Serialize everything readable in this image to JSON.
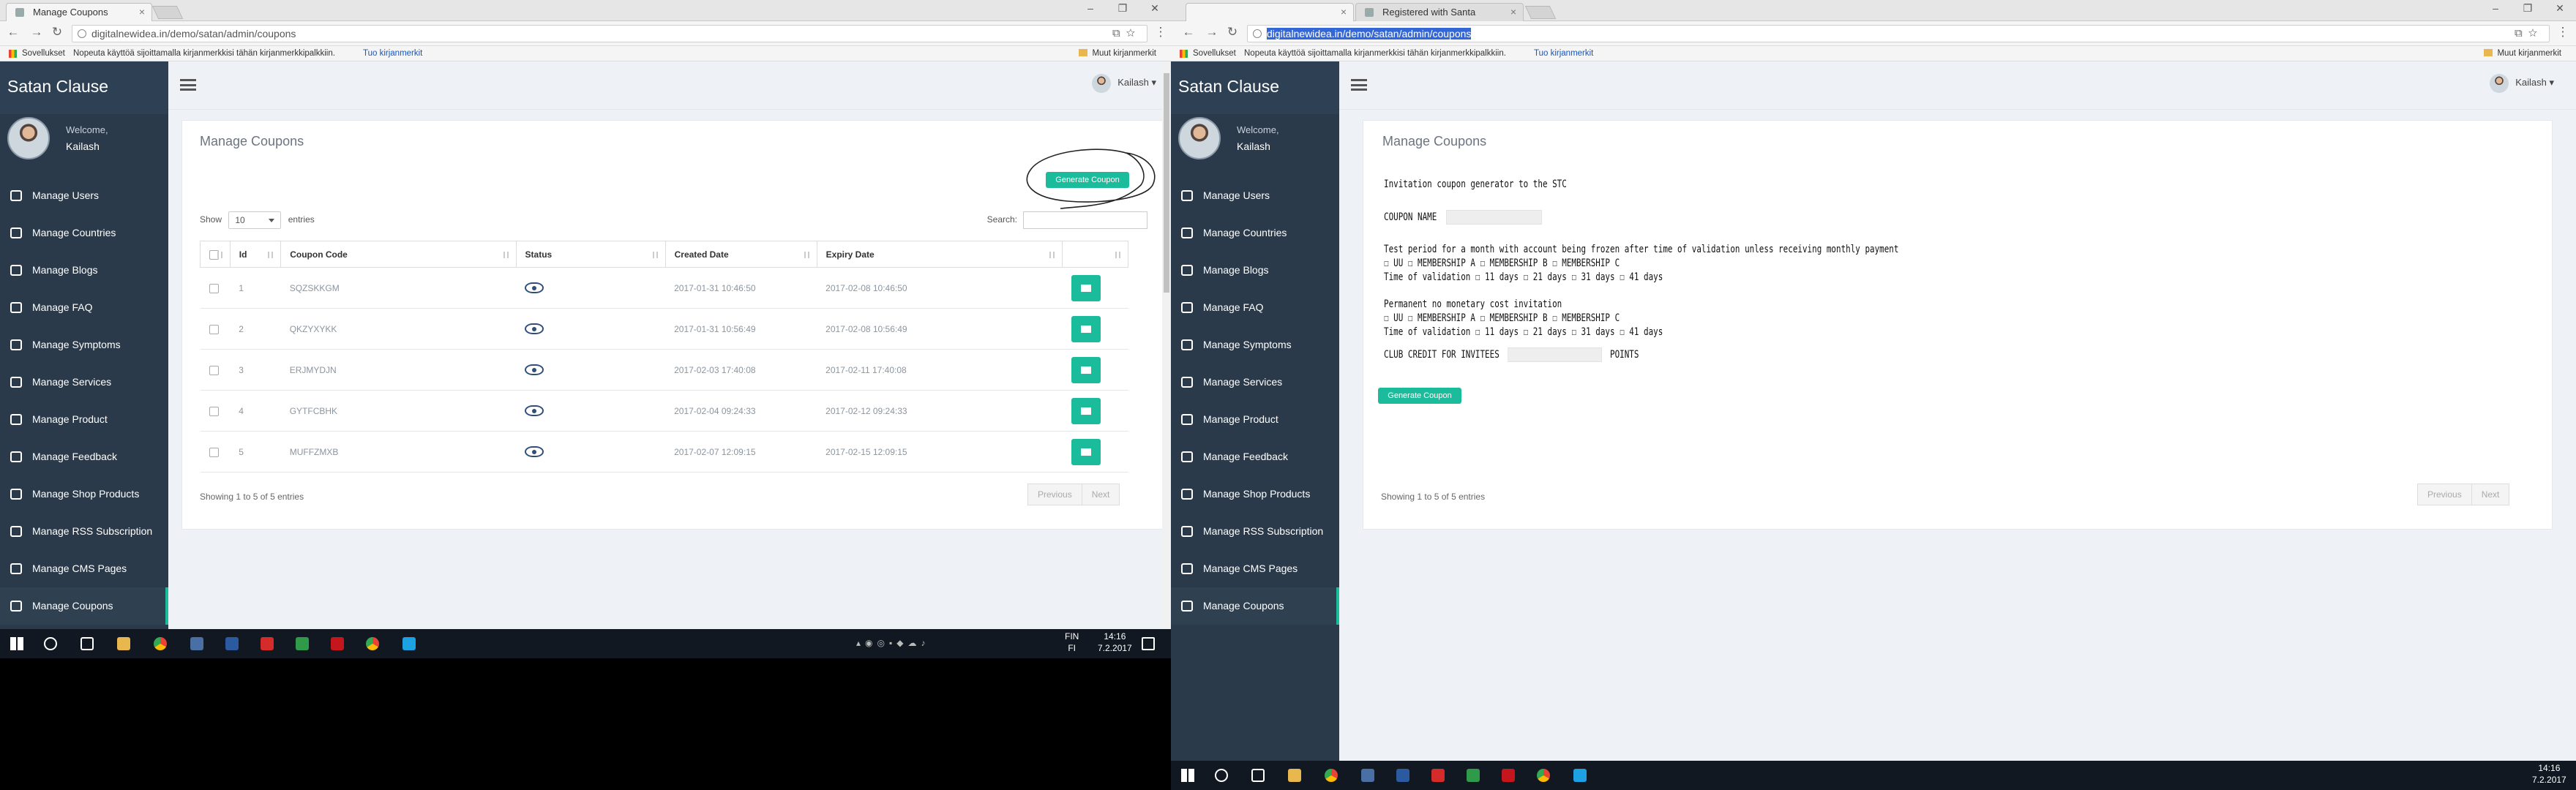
{
  "left": {
    "tabs": [
      {
        "title": "Manage Coupons"
      }
    ],
    "address": {
      "url": "digitalnewidea.in/demo/satan/admin/coupons"
    },
    "bookmarks": {
      "apps": "Sovellukset",
      "hint": "Nopeuta käyttöä sijoittamalla kirjanmerkkisi tähän kirjanmerkkipalkkiin.",
      "import": "Tuo kirjanmerkit",
      "other": "Muut kirjanmerkit"
    }
  },
  "right": {
    "tabs": [
      {
        "title": ""
      },
      {
        "title": "Registered with Santa"
      }
    ],
    "address": {
      "url": "digitalnewidea.in/demo/satan/admin/coupons"
    },
    "bookmarks": {
      "apps": "Sovellukset",
      "hint": "Nopeuta käyttöä sijoittamalla kirjanmerkkisi tähän kirjanmerkkipalkkiin.",
      "import": "Tuo kirjanmerkit",
      "other": "Muut kirjanmerkit"
    }
  },
  "app": {
    "brand": "Satan Clause",
    "welcome": "Welcome,",
    "user": "Kailash",
    "menu": [
      {
        "label": "Manage Users",
        "icon": "users-icon"
      },
      {
        "label": "Manage Countries",
        "icon": "map-icon"
      },
      {
        "label": "Manage Blogs",
        "icon": "edit-icon"
      },
      {
        "label": "Manage FAQ",
        "icon": "question-icon"
      },
      {
        "label": "Manage Symptoms",
        "icon": "gear-icon"
      },
      {
        "label": "Manage Services",
        "icon": "lifebuoy-icon"
      },
      {
        "label": "Manage Product",
        "icon": "cube-icon"
      },
      {
        "label": "Manage Feedback",
        "icon": "info-icon"
      },
      {
        "label": "Manage Shop Products",
        "icon": "cog-icon"
      },
      {
        "label": "Manage RSS Subscription",
        "icon": "rss-icon"
      },
      {
        "label": "Manage CMS Pages",
        "icon": "edit-icon"
      },
      {
        "label": "Manage Coupons",
        "icon": "list-icon"
      }
    ],
    "accent": "#1abc9c",
    "sidebar_color": "#2b3a4a"
  },
  "coupons_page": {
    "title": "Manage Coupons",
    "generate_label": "Generate Coupon",
    "show": "Show",
    "length_value": "10",
    "entries": "entries",
    "search_label": "Search:",
    "columns": [
      "",
      "Id",
      "Coupon Code",
      "Status",
      "Created Date",
      "Expiry Date",
      ""
    ],
    "rows": [
      {
        "id": "1",
        "code": "SQZSKKGM",
        "created": "2017-01-31 10:46:50",
        "expiry": "2017-02-08 10:46:50"
      },
      {
        "id": "2",
        "code": "QKZYXYKK",
        "created": "2017-01-31 10:56:49",
        "expiry": "2017-02-08 10:56:49"
      },
      {
        "id": "3",
        "code": "ERJMYDJN",
        "created": "2017-02-03 17:40:08",
        "expiry": "2017-02-11 17:40:08"
      },
      {
        "id": "4",
        "code": "GYTFCBHK",
        "created": "2017-02-04 09:24:33",
        "expiry": "2017-02-12 09:24:33"
      },
      {
        "id": "5",
        "code": "MUFFZMXB",
        "created": "2017-02-07 12:09:15",
        "expiry": "2017-02-15 12:09:15"
      }
    ],
    "info": "Showing 1 to 5 of 5 entries",
    "prev": "Previous",
    "next": "Next"
  },
  "generator_page": {
    "title": "Manage Coupons",
    "heading": "Invitation coupon generator to the STC",
    "coupon_name_label": "COUPON NAME",
    "test_heading": "Test period for a month with account being frozen after time of validation unless receiving monthly payment",
    "test_memberships": "☐ UU ☐ MEMBERSHIP A ☐ MEMBERSHIP B ☐ MEMBERSHIP C",
    "test_validation": "Time of validation ☐ 11 days ☐ 21 days ☐ 31 days ☐ 41 days",
    "perm_heading": "Permanent no monetary cost invitation",
    "perm_memberships": "☐ UU ☐ MEMBERSHIP A ☐ MEMBERSHIP B ☐ MEMBERSHIP C",
    "perm_validation": "Time of validation ☐ 11 days ☐ 21 days ☐ 31 days ☐ 41 days",
    "club_label": "CLUB CREDIT FOR INVITEES",
    "points_label": "POINTS",
    "generate_label": "Generate Coupon",
    "info": "Showing 1 to 5 of 5 entries",
    "prev": "Previous",
    "next": "Next"
  },
  "taskbar_left": {
    "lang": "FIN",
    "lang2": "FI",
    "time": "14:16",
    "date": "7.2.2017"
  },
  "taskbar_right": {
    "time": "14:16",
    "date": "7.2.2017"
  }
}
